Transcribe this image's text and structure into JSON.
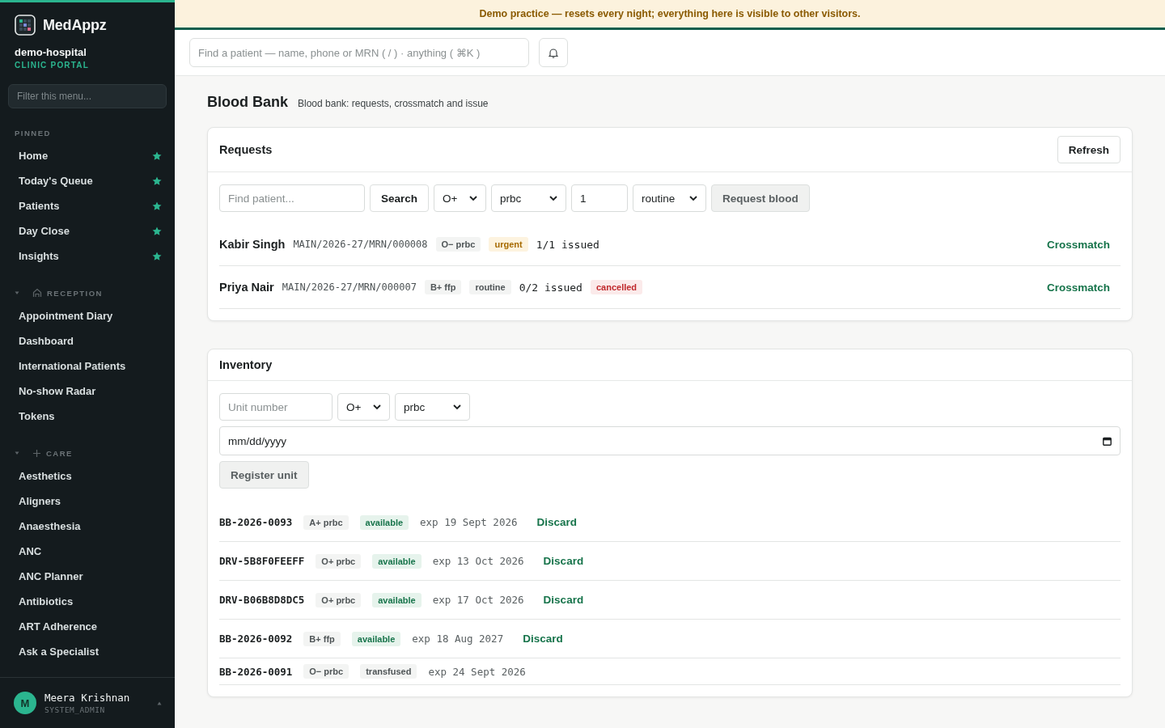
{
  "sidebar": {
    "brand": "MedAppz",
    "org": "demo-hospital",
    "org_subtitle": "CLINIC PORTAL",
    "filter": {
      "placeholder": "Filter this menu..."
    },
    "sections": [
      {
        "kind": "pinned",
        "title": "PINNED",
        "items": [
          {
            "label": "Home",
            "pinned": true
          },
          {
            "label": "Today's Queue",
            "pinned": true
          },
          {
            "label": "Patients",
            "pinned": true
          },
          {
            "label": "Day Close",
            "pinned": true
          },
          {
            "label": "Insights",
            "pinned": true
          }
        ]
      },
      {
        "kind": "collapsible",
        "title": "RECEPTION",
        "expanded": true,
        "items": [
          {
            "label": "Appointment Diary"
          },
          {
            "label": "Dashboard"
          },
          {
            "label": "International Patients"
          },
          {
            "label": "No-show Radar"
          },
          {
            "label": "Tokens"
          }
        ]
      },
      {
        "kind": "collapsible",
        "title": "CARE",
        "expanded": true,
        "items": [
          {
            "label": "Aesthetics"
          },
          {
            "label": "Aligners"
          },
          {
            "label": "Anaesthesia"
          },
          {
            "label": "ANC"
          },
          {
            "label": "ANC Planner"
          },
          {
            "label": "Antibiotics"
          },
          {
            "label": "ART Adherence"
          },
          {
            "label": "Ask a Specialist"
          }
        ]
      }
    ],
    "user": {
      "initial": "M",
      "name": "Meera Krishnan",
      "role": "SYSTEM_ADMIN"
    }
  },
  "banner": "Demo practice — resets every night; everything here is visible to other visitors.",
  "topbar": {
    "search": {
      "placeholder": "Find a patient — name, phone or MRN ( / ) · anything ( ⌘K )"
    }
  },
  "page": {
    "title": "Blood Bank",
    "subtitle": "Blood bank: requests, crossmatch and issue"
  },
  "requests": {
    "title": "Requests",
    "refresh": "Refresh",
    "form": {
      "patient": {
        "placeholder": "Find patient..."
      },
      "search": "Search",
      "group": "O+",
      "product": "prbc",
      "units": "1",
      "priority": "routine",
      "submit": "Request blood"
    },
    "rows": [
      {
        "name": "Kabir Singh",
        "mrn": "MAIN/2026-27/MRN/000008",
        "blood": "O− prbc",
        "priority": {
          "label": "urgent",
          "kind": "warning"
        },
        "issued": "1/1 issued",
        "action": "Crossmatch"
      },
      {
        "name": "Priya Nair",
        "mrn": "MAIN/2026-27/MRN/000007",
        "blood": "B+ ffp",
        "priority": {
          "label": "routine",
          "kind": "neutral"
        },
        "issued": "0/2 issued",
        "status": {
          "label": "cancelled",
          "kind": "danger"
        },
        "action": "Crossmatch"
      }
    ]
  },
  "inventory": {
    "title": "Inventory",
    "form": {
      "unit": {
        "placeholder": "Unit number"
      },
      "group": "O+",
      "product": "prbc",
      "expiry": {
        "value": "mm/dd/yyyy"
      },
      "submit": "Register unit"
    },
    "rows": [
      {
        "unit": "BB-2026-0093",
        "product": "A+ prbc",
        "status": {
          "label": "available",
          "kind": "success"
        },
        "expiry": "exp 19 Sept 2026",
        "action": "Discard"
      },
      {
        "unit": "DRV-5B8F0FEEFF",
        "product": "O+ prbc",
        "status": {
          "label": "available",
          "kind": "success"
        },
        "expiry": "exp 13 Oct 2026",
        "action": "Discard"
      },
      {
        "unit": "DRV-B06B8D8DC5",
        "product": "O+ prbc",
        "status": {
          "label": "available",
          "kind": "success"
        },
        "expiry": "exp 17 Oct 2026",
        "action": "Discard"
      },
      {
        "unit": "BB-2026-0092",
        "product": "B+ ffp",
        "status": {
          "label": "available",
          "kind": "success"
        },
        "expiry": "exp 18 Aug 2027",
        "action": "Discard"
      },
      {
        "unit": "BB-2026-0091",
        "product": "O− prbc",
        "status": {
          "label": "transfused",
          "kind": "neutral"
        },
        "expiry": "exp 24 Sept 2026"
      }
    ]
  }
}
